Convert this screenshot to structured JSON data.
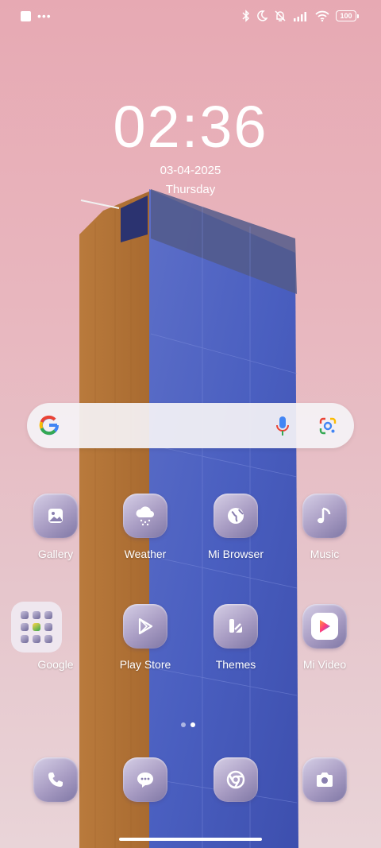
{
  "status_bar": {
    "left_icons": [
      "notification-square-icon",
      "more-dots-icon"
    ],
    "right_icons": [
      "bluetooth-icon",
      "moon-icon",
      "bell-off-icon",
      "signal-icon",
      "wifi-icon",
      "battery-icon"
    ],
    "battery_level": "100"
  },
  "clock": {
    "time": "02:36",
    "date": "03-04-2025",
    "day": "Thursday"
  },
  "search_bar": {
    "icons": [
      "google-logo-icon",
      "microphone-icon",
      "google-lens-icon"
    ]
  },
  "apps": {
    "row1": [
      {
        "label": "Gallery",
        "icon": "gallery-icon"
      },
      {
        "label": "Weather",
        "icon": "weather-icon"
      },
      {
        "label": "Mi Browser",
        "icon": "globe-icon"
      },
      {
        "label": "Music",
        "icon": "music-note-icon"
      }
    ],
    "row2": [
      {
        "label": "Google",
        "icon": "folder-icon"
      },
      {
        "label": "Play Store",
        "icon": "play-store-icon"
      },
      {
        "label": "Themes",
        "icon": "themes-icon"
      },
      {
        "label": "Mi Video",
        "icon": "video-play-icon"
      }
    ],
    "dock": [
      {
        "icon": "phone-icon"
      },
      {
        "icon": "messages-icon"
      },
      {
        "icon": "chrome-icon"
      },
      {
        "icon": "camera-icon"
      }
    ]
  },
  "pages": {
    "count": 2,
    "current": 2
  },
  "colors": {
    "wallpaper_top": "#e7a9b3",
    "icon_tint": "#a89cc3"
  }
}
